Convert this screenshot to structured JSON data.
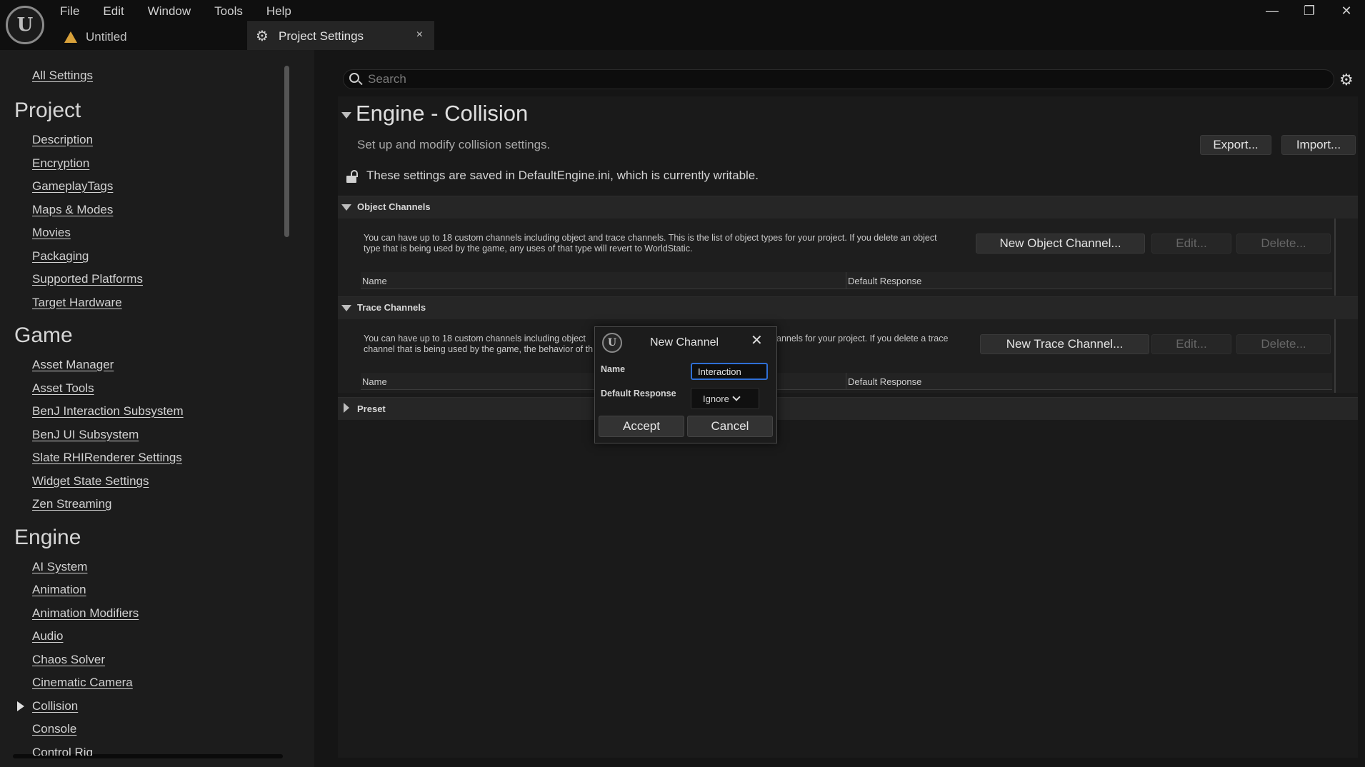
{
  "menubar": [
    "File",
    "Edit",
    "Window",
    "Tools",
    "Help"
  ],
  "logo_letter": "U",
  "doc_tab": {
    "label": "Untitled"
  },
  "settings_tab": {
    "label": "Project Settings",
    "close": "×"
  },
  "window_controls": {
    "minimize": "—",
    "restore": "❐",
    "close": "✕"
  },
  "sidebar": {
    "all_settings": "All Settings",
    "project": {
      "heading": "Project",
      "items": [
        "Description",
        "Encryption",
        "GameplayTags",
        "Maps & Modes",
        "Movies",
        "Packaging",
        "Supported Platforms",
        "Target Hardware"
      ]
    },
    "game": {
      "heading": "Game",
      "items": [
        "Asset Manager",
        "Asset Tools",
        "BenJ Interaction Subsystem",
        "BenJ UI Subsystem",
        "Slate RHIRenderer Settings",
        "Widget State Settings",
        "Zen Streaming"
      ]
    },
    "engine": {
      "heading": "Engine",
      "items": [
        "AI System",
        "Animation",
        "Animation Modifiers",
        "Audio",
        "Chaos Solver",
        "Cinematic Camera",
        "Collision",
        "Console",
        "Control Rig"
      ]
    }
  },
  "search": {
    "placeholder": "Search"
  },
  "section": {
    "title": "Engine - Collision",
    "subtitle": "Set up and modify collision settings.",
    "export_label": "Export...",
    "import_label": "Import...",
    "config_note": "These settings are saved in DefaultEngine.ini, which is currently writable."
  },
  "object_channels": {
    "label": "Object Channels",
    "help_line1": "You can have up to 18 custom channels including object and trace channels. This is the list of object types for your project. If you delete an object",
    "help_line2": "type that is being used by the game, any uses of that type will revert to WorldStatic.",
    "new_label": "New Object Channel...",
    "edit_label": "Edit...",
    "delete_label": "Delete...",
    "col_name": "Name",
    "col_response": "Default Response"
  },
  "trace_channels": {
    "label": "Trace Channels",
    "help_line1_left": "You can have up to 18 custom channels including object",
    "help_line1_right": "annels for your project. If you delete a trace",
    "help_line2_left": "channel that is being used by the game, the behavior of th",
    "new_label": "New Trace Channel...",
    "edit_label": "Edit...",
    "delete_label": "Delete...",
    "col_name": "Name",
    "col_response": "Default Response"
  },
  "preset": {
    "label": "Preset"
  },
  "dialog": {
    "title": "New Channel",
    "name_label": "Name",
    "name_value": "Interaction",
    "response_label": "Default Response",
    "response_value": "Ignore",
    "accept_label": "Accept",
    "cancel_label": "Cancel"
  },
  "colors": {
    "accent": "#2f6fd6",
    "background": "#151515",
    "panel": "#1c1c1c",
    "warning": "#d8a13a"
  }
}
